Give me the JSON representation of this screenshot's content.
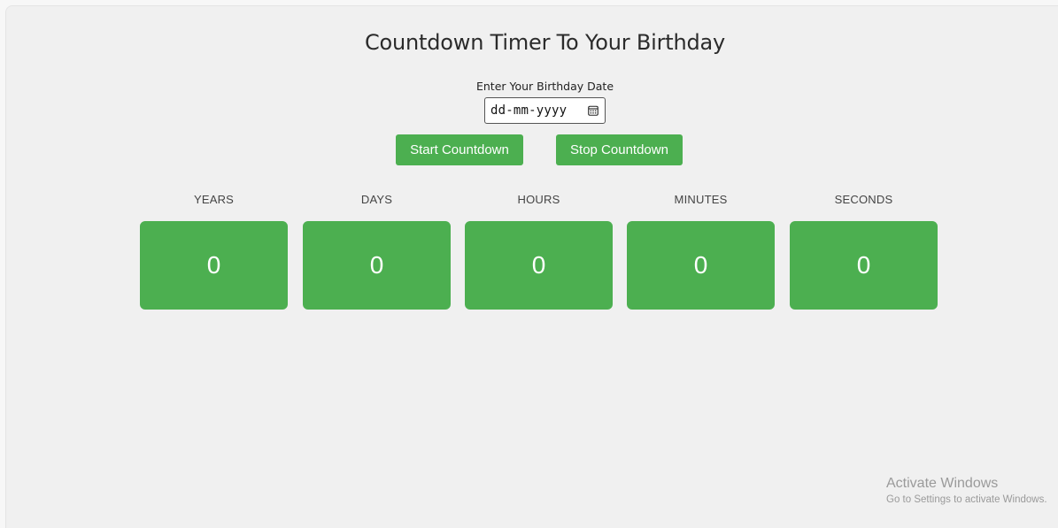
{
  "page": {
    "title": "Countdown Timer To Your Birthday"
  },
  "birthday": {
    "label": "Enter Your Birthday Date",
    "placeholder": "dd-mm-yyyy",
    "value": "",
    "icon": "calendar-icon"
  },
  "buttons": {
    "start_label": "Start Countdown",
    "stop_label": "Stop Countdown"
  },
  "countdown": {
    "units": [
      {
        "label": "YEARS",
        "value": "0"
      },
      {
        "label": "DAYS",
        "value": "0"
      },
      {
        "label": "HOURS",
        "value": "0"
      },
      {
        "label": "MINUTES",
        "value": "0"
      },
      {
        "label": "SECONDS",
        "value": "0"
      }
    ]
  },
  "watermark": {
    "title": "Activate Windows",
    "subtitle": "Go to Settings to activate Windows."
  },
  "colors": {
    "accent": "#4caf50",
    "background": "#f0f0f0",
    "text": "#2b2b2b"
  }
}
